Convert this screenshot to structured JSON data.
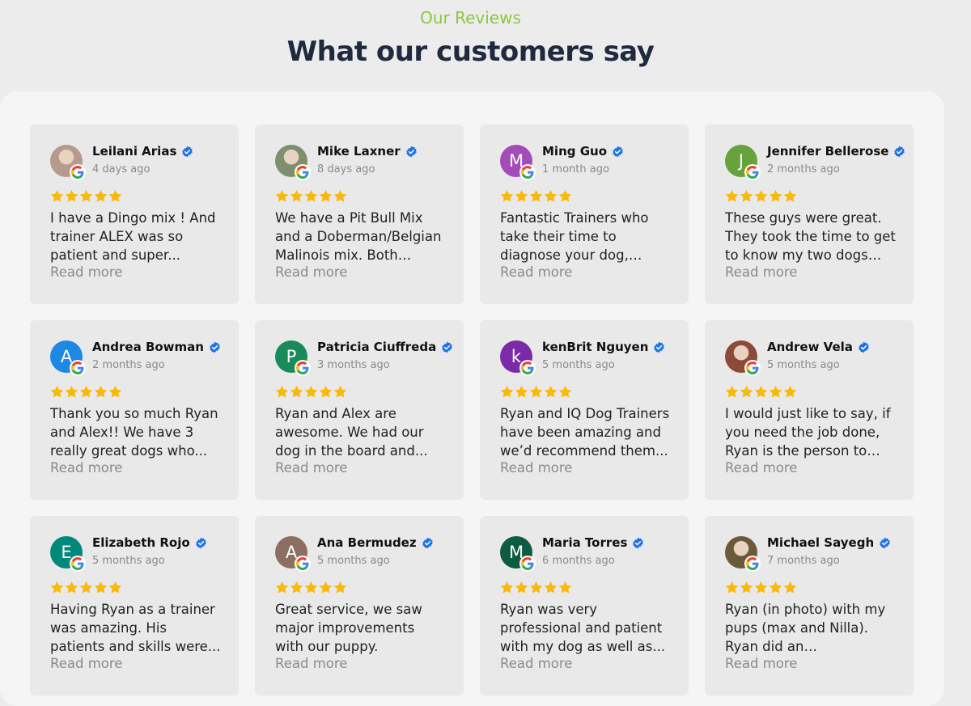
{
  "section": {
    "eyebrow": "Our Reviews",
    "title": "What our customers say"
  },
  "read_more_label": "Read more",
  "colors": {
    "eyebrow": "#8dc63f",
    "star": "#f8b80c",
    "verified": "#1a73e8"
  },
  "reviews": [
    {
      "name": "Leilani Arias",
      "date": "4 days ago",
      "initial": "",
      "avatar_type": "photo",
      "avatar_color": "#b79a8e",
      "rating": 5,
      "text": "I have a Dingo mix ! And trainer ALEX was so patient and super..."
    },
    {
      "name": "Mike Laxner",
      "date": "8 days ago",
      "initial": "",
      "avatar_type": "photo",
      "avatar_color": "#7e8f6f",
      "rating": 5,
      "text": "We have a Pit Bull Mix and a Doberman/Belgian Malinois mix. Both were..."
    },
    {
      "name": "Ming Guo",
      "date": "1 month ago",
      "initial": "M",
      "avatar_type": "letter",
      "avatar_color": "#a34bb8",
      "rating": 5,
      "text": "Fantastic Trainers who take their time to diagnose your dog, work..."
    },
    {
      "name": "Jennifer Bellerose",
      "date": "2 months ago",
      "initial": "J",
      "avatar_type": "letter",
      "avatar_color": "#66a33a",
      "rating": 5,
      "text": "These guys were great. They took the time to get to know my two dogs an..."
    },
    {
      "name": "Andrea Bowman",
      "date": "2 months ago",
      "initial": "A",
      "avatar_type": "letter",
      "avatar_color": "#1e88e5",
      "rating": 5,
      "text": "Thank you so much Ryan and Alex!! We have 3 really great dogs who..."
    },
    {
      "name": "Patricia Ciuffreda",
      "date": "3 months ago",
      "initial": "P",
      "avatar_type": "letter",
      "avatar_color": "#1b8a5a",
      "rating": 5,
      "text": "Ryan and Alex are awesome. We had our dog in the board and..."
    },
    {
      "name": "kenBrit Nguyen",
      "date": "5 months ago",
      "initial": "k",
      "avatar_type": "letter",
      "avatar_color": "#7b2aa8",
      "rating": 5,
      "text": "Ryan and IQ Dog Trainers have been amazing and we’d recommend them..."
    },
    {
      "name": "Andrew Vela",
      "date": "5 months ago",
      "initial": "",
      "avatar_type": "photo",
      "avatar_color": "#8c4a3a",
      "rating": 5,
      "text": "I would just like to say, if you need the job done, Ryan is the person to go..."
    },
    {
      "name": "Elizabeth Rojo",
      "date": "5 months ago",
      "initial": "E",
      "avatar_type": "letter",
      "avatar_color": "#00897b",
      "rating": 5,
      "text": "Having Ryan as a trainer was amazing. His patients and skills were..."
    },
    {
      "name": "Ana Bermudez",
      "date": "5 months ago",
      "initial": "A",
      "avatar_type": "letter",
      "avatar_color": "#8d6e63",
      "rating": 5,
      "text": "Great service, we saw major improvements with our puppy."
    },
    {
      "name": "Maria Torres",
      "date": "6 months ago",
      "initial": "M",
      "avatar_type": "letter",
      "avatar_color": "#0d5c3f",
      "rating": 5,
      "text": "Ryan was very professional and patient with my dog as well as..."
    },
    {
      "name": "Michael Sayegh",
      "date": "7 months ago",
      "initial": "",
      "avatar_type": "photo",
      "avatar_color": "#6b5a3a",
      "rating": 5,
      "text": "Ryan (in photo) with my pups (max and Nilla). Ryan did an exceptional..."
    }
  ]
}
